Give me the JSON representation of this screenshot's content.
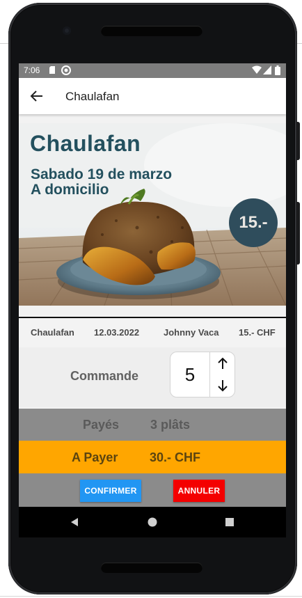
{
  "status_bar": {
    "time": "7:06"
  },
  "app_bar": {
    "title": "Chaulafan",
    "back_icon": "arrow-left-icon"
  },
  "hero": {
    "title": "Chaulafan",
    "date": "Sabado 19 de marzo",
    "mode": "A domicilio",
    "price_badge": "15.-"
  },
  "info": {
    "dish": "Chaulafan",
    "date": "12.03.2022",
    "cook": "Johnny Vaca",
    "price": "15.- CHF"
  },
  "order": {
    "label": "Commande",
    "quantity": "5"
  },
  "paid": {
    "label": "Payés",
    "value": "3 plâts"
  },
  "to_pay": {
    "label": "A Payer",
    "value": "30.- CHF"
  },
  "buttons": {
    "confirm": "CONFIRMER",
    "cancel": "ANNULER"
  },
  "colors": {
    "accent_orange": "#ffa600",
    "confirm_blue": "#2196f3",
    "cancel_red": "#f40000",
    "hero_text": "#23505e"
  }
}
